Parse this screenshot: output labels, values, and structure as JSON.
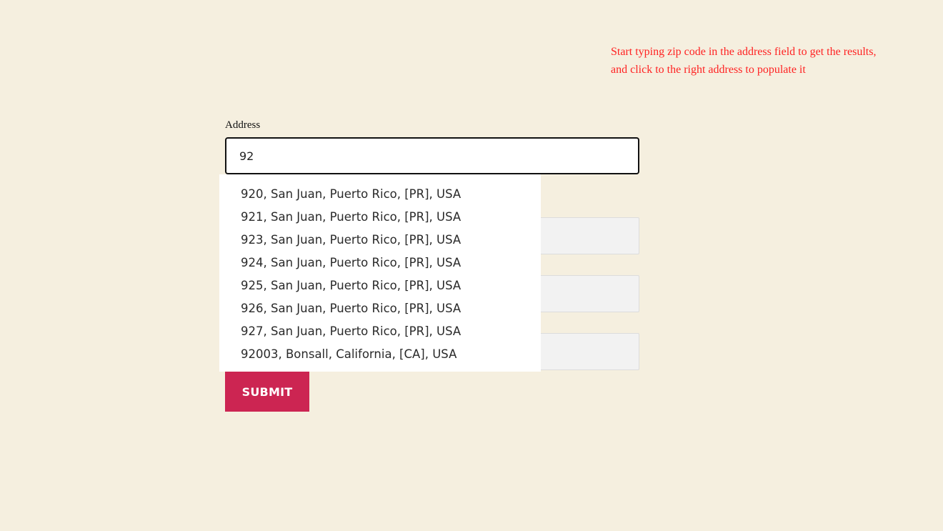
{
  "hint": {
    "line1": "Start typing zip code in the address field to get the results,",
    "line2": "and click to the right address to populate it"
  },
  "address": {
    "label": "Address",
    "value": "92"
  },
  "suggestions": [
    "920, San Juan, Puerto Rico, [PR], USA",
    "921, San Juan, Puerto Rico, [PR], USA",
    "923, San Juan, Puerto Rico, [PR], USA",
    "924, San Juan, Puerto Rico, [PR], USA",
    "925, San Juan, Puerto Rico, [PR], USA",
    "926, San Juan, Puerto Rico, [PR], USA",
    "927, San Juan, Puerto Rico, [PR], USA",
    "92003, Bonsall, California, [CA], USA"
  ],
  "submit": {
    "label": "SUBMIT"
  },
  "colors": {
    "background": "#f5efdf",
    "hint_text": "#ff2222",
    "submit_bg": "#cc2552"
  }
}
